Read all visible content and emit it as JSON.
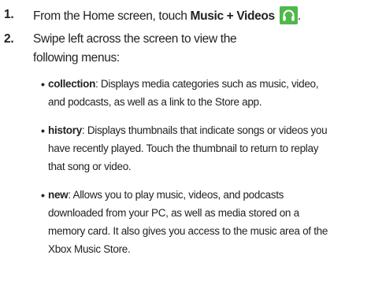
{
  "steps": [
    {
      "number": "1.",
      "text_before": "From the Home screen, touch ",
      "bold": "Music + Videos",
      "icon": "headphones-icon",
      "text_after": "."
    },
    {
      "number": "2.",
      "line1": "Swipe left across the screen to view the",
      "line2": "following menus:"
    }
  ],
  "bullets": [
    {
      "term": "collection",
      "lines": [
        ": Displays media categories such as music, video,",
        "and podcasts, as well as a link to the Store app."
      ]
    },
    {
      "term": "history",
      "lines": [
        ": Displays thumbnails that indicate songs or videos you",
        "have recently played. Touch the thumbnail to return to replay",
        "that song or video."
      ]
    },
    {
      "term": "new",
      "lines": [
        ": Allows you to play music, videos, and podcasts",
        "downloaded from your PC, as well as media stored on a",
        "memory card. It also gives you access to the music area of the",
        "Xbox Music Store."
      ]
    }
  ],
  "colors": {
    "icon_background": "#4fb848",
    "text": "#222222"
  }
}
